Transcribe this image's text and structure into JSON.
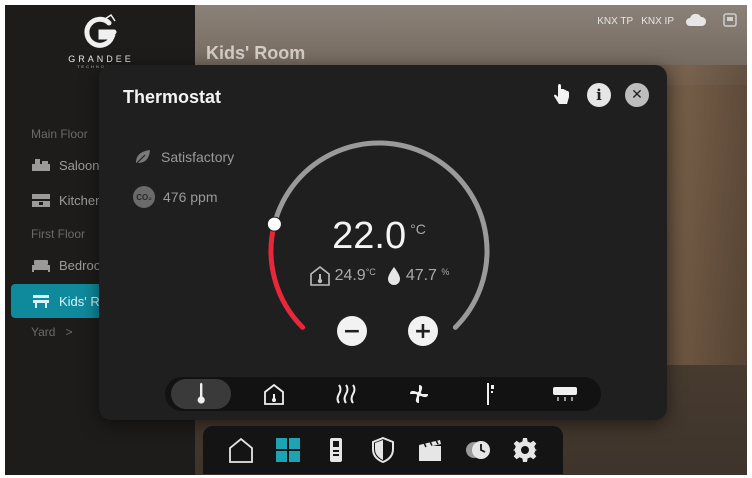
{
  "brand": {
    "name": "GRANDEE",
    "tagline": "TECHNOLOGY"
  },
  "top_status": {
    "knx_tp": "KNX TP",
    "knx_ip": "KNX IP",
    "cloud_icon": "cloud-icon",
    "screen_icon": "screen-icon"
  },
  "sidebar": {
    "sections": [
      {
        "label": "Main Floor"
      },
      {
        "label": "First Floor"
      }
    ],
    "items": [
      {
        "label": "Saloon",
        "icon": "sofa-icon"
      },
      {
        "label": "Kitchen",
        "icon": "kitchen-icon"
      },
      {
        "label": "Bedroom",
        "icon": "bed-icon"
      },
      {
        "label": "Kids' Room",
        "icon": "kids-room-icon",
        "active": true
      }
    ],
    "yard": {
      "label": "Yard",
      "chevron": ">"
    }
  },
  "room_title": "Kids' Room",
  "modal": {
    "title": "Thermostat",
    "comfort_status": "Satisfactory",
    "co2": {
      "badge": "CO₂",
      "value": "476 ppm"
    },
    "setpoint": {
      "value": "22.0",
      "unit": "°C"
    },
    "indoor_temp": {
      "value": "24.9",
      "unit": "°C"
    },
    "humidity": {
      "value": "47.7",
      "unit": "%"
    },
    "minus_label": "−",
    "plus_label": "+",
    "info_label": "i",
    "close_label": "✕",
    "modes": [
      {
        "icon": "thermometer-icon",
        "active": true
      },
      {
        "icon": "home-icon"
      },
      {
        "icon": "heating-icon"
      },
      {
        "icon": "fan-icon"
      },
      {
        "icon": "floor-heating-icon"
      },
      {
        "icon": "air-conditioner-icon"
      }
    ],
    "setpoint_fraction": 0.22,
    "colors": {
      "heat_arc": "#e8283a",
      "track_arc": "#9a9a9a",
      "accent": "#0f8a9c"
    }
  },
  "dock": [
    {
      "icon": "home-icon"
    },
    {
      "icon": "grid-icon",
      "active": true,
      "color": "#1ea3b5"
    },
    {
      "icon": "intercom-icon"
    },
    {
      "icon": "shield-icon"
    },
    {
      "icon": "scene-icon"
    },
    {
      "icon": "schedule-icon"
    },
    {
      "icon": "settings-icon"
    }
  ]
}
